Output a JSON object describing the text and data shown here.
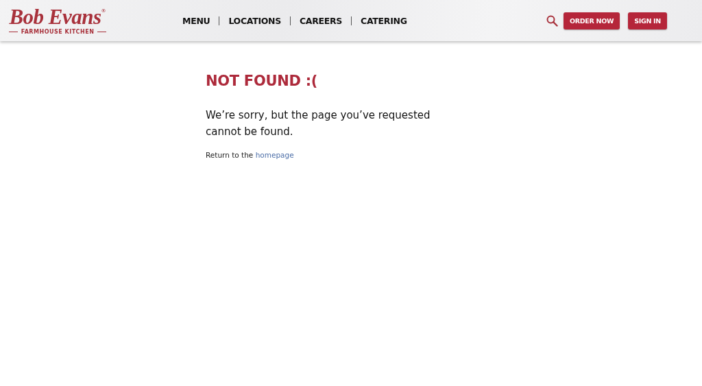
{
  "header": {
    "logo": {
      "name": "Bob Evans",
      "mark": "®",
      "tagline": "FARMHOUSE KITCHEN"
    },
    "nav": [
      {
        "label": "MENU"
      },
      {
        "label": "LOCATIONS"
      },
      {
        "label": "CAREERS"
      },
      {
        "label": "CATERING"
      }
    ],
    "buttons": [
      {
        "label": "ORDER NOW"
      },
      {
        "label": "SIGN IN"
      }
    ]
  },
  "content": {
    "title": "NOT FOUND :(",
    "message": "We’re sorry, but the page you’ve requested cannot be found.",
    "return_text": "Return to the",
    "link": "homepage"
  }
}
